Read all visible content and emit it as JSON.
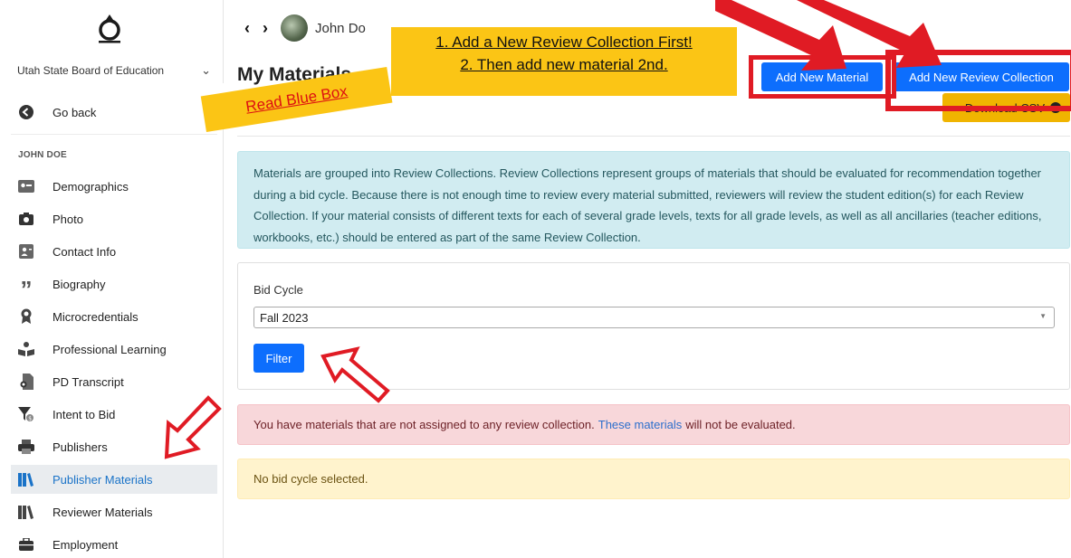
{
  "sidebar": {
    "org_name": "Utah State Board of Education",
    "go_back": "Go back",
    "user_heading": "JOHN DOE",
    "items": [
      {
        "label": "Demographics",
        "icon": "id-card-icon"
      },
      {
        "label": "Photo",
        "icon": "camera-icon"
      },
      {
        "label": "Contact Info",
        "icon": "contact-card-icon"
      },
      {
        "label": "Biography",
        "icon": "quote-icon"
      },
      {
        "label": "Microcredentials",
        "icon": "award-icon"
      },
      {
        "label": "Professional Learning",
        "icon": "reading-person-icon"
      },
      {
        "label": "PD Transcript",
        "icon": "certificate-icon"
      },
      {
        "label": "Intent to Bid",
        "icon": "funnel-dollar-icon"
      },
      {
        "label": "Publishers",
        "icon": "printer-icon"
      },
      {
        "label": "Publisher Materials",
        "icon": "books-icon",
        "active": true
      },
      {
        "label": "Reviewer Materials",
        "icon": "books-icon"
      },
      {
        "label": "Employment",
        "icon": "briefcase-icon"
      }
    ]
  },
  "header": {
    "user_name": "John Do",
    "title": "My Materials",
    "add_material": "Add New Material",
    "add_collection": "Add New Review Collection",
    "download": "Download CSV"
  },
  "annotations": {
    "step1": "1. Add a New Review Collection First!",
    "step2": "2. Then add new material 2nd.",
    "read_blue": "Read Blue Box",
    "highlight_color": "#fbc515",
    "arrow_color": "#e01b24"
  },
  "info": {
    "text": "Materials are grouped into Review Collections. Review Collections represent groups of materials that should be evaluated for recommendation together during a bid cycle. Because there is not enough time to review every material submitted, reviewers will review the student edition(s) for each Review Collection. If your material consists of different texts for each of several grade levels, texts for all grade levels, as well as all ancillaries (teacher editions, workbooks, etc.) should be entered as part of the same Review Collection."
  },
  "filter": {
    "label": "Bid Cycle",
    "selected": "Fall 2023",
    "button": "Filter"
  },
  "alerts": {
    "danger_before": "You have materials that are not assigned to any review collection.",
    "danger_link": "These materials",
    "danger_after": "will not be evaluated.",
    "warning": "No bid cycle selected."
  }
}
